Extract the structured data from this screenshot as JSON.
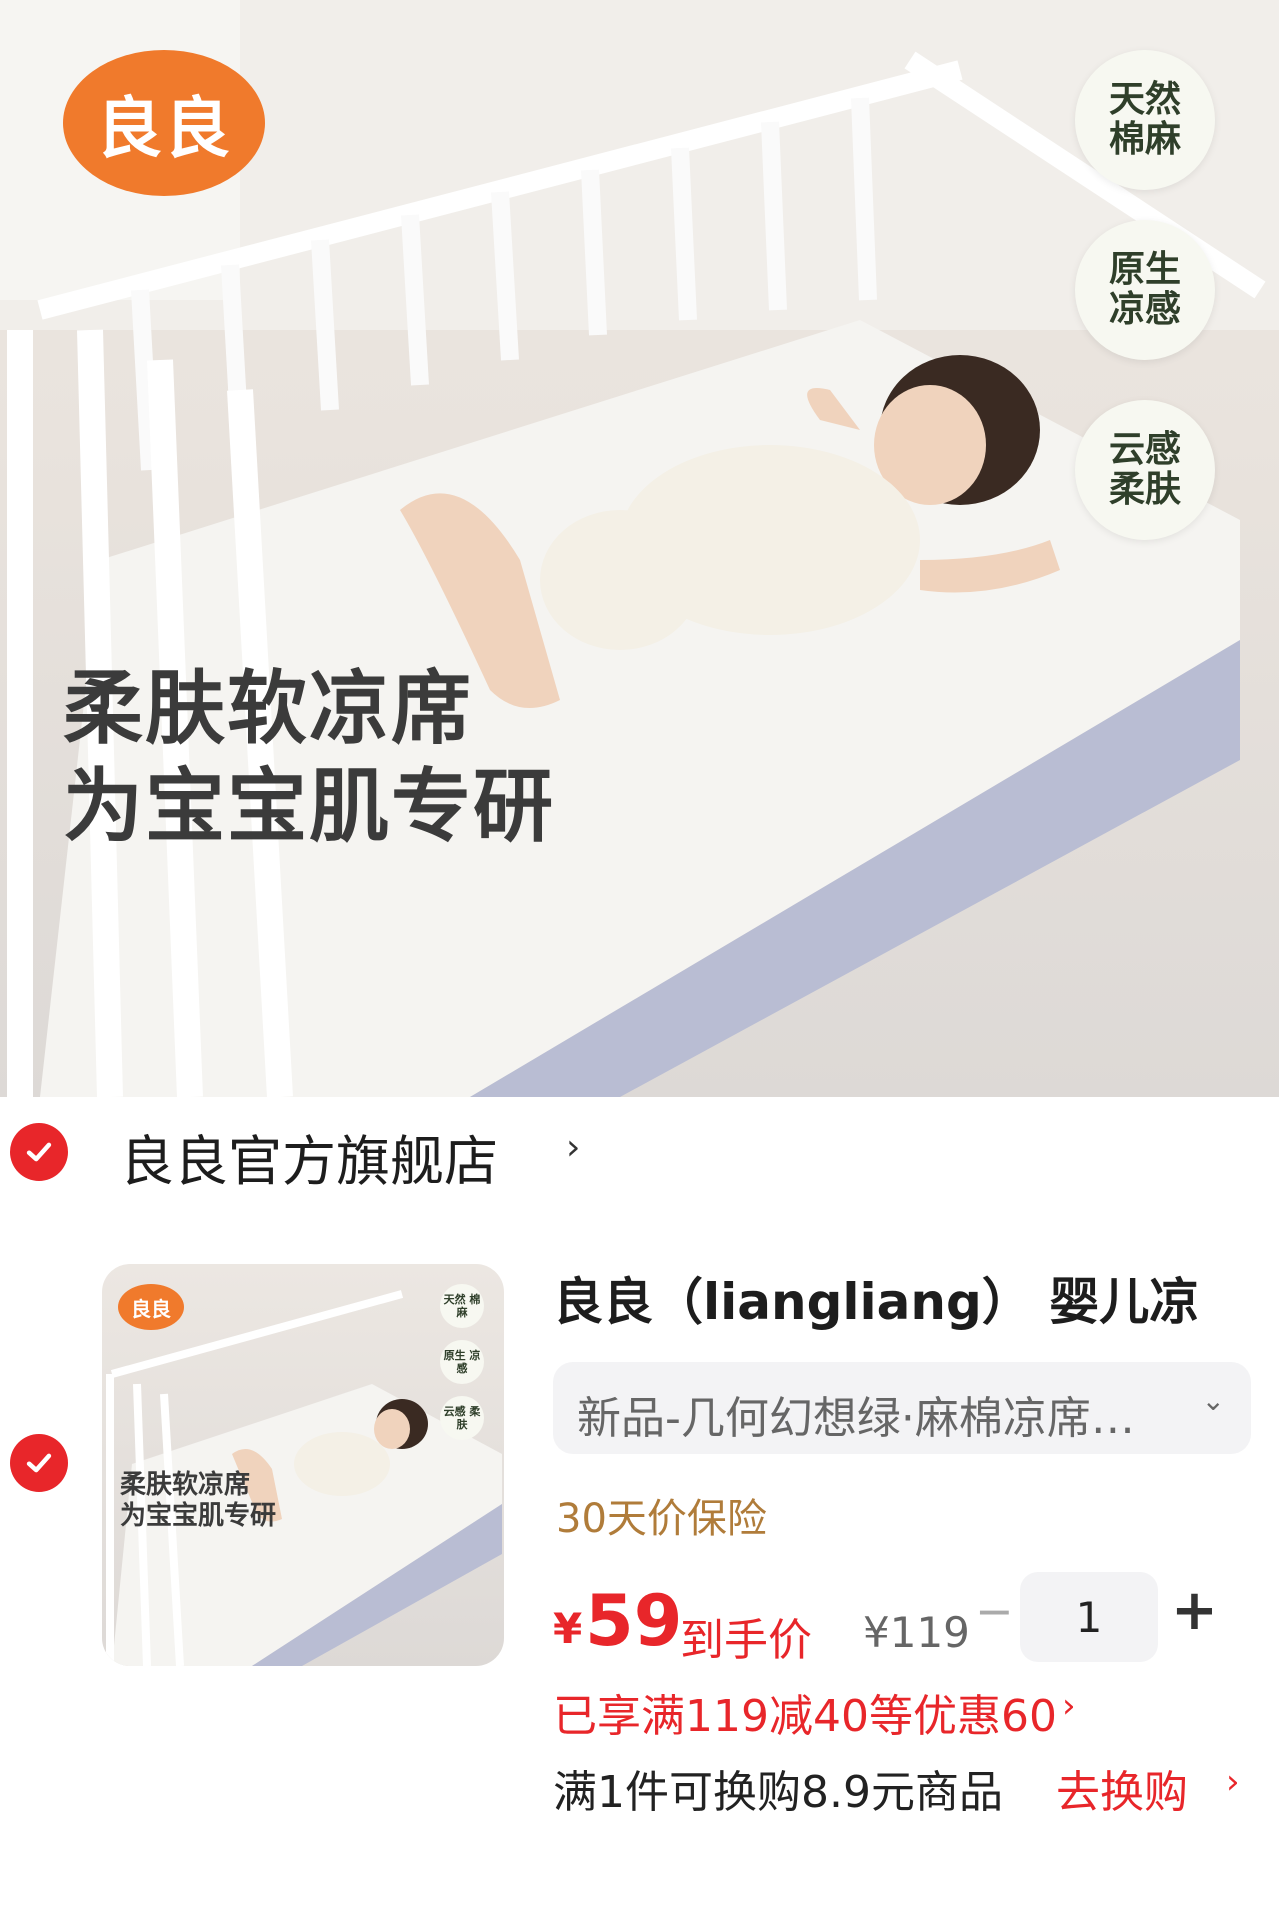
{
  "hero": {
    "brand_logo": "良良",
    "badges": [
      "天然\n棉麻",
      "原生\n凉感",
      "云感\n柔肤"
    ],
    "title_line1": "柔肤软凉席",
    "title_line2": "为宝宝肌专研"
  },
  "store": {
    "name": "良良官方旗舰店",
    "chevron": "›",
    "checkbox_checked": true
  },
  "product": {
    "checkbox_checked": true,
    "thumbnail": {
      "brand_logo": "良良",
      "badges": [
        "天然\n棉麻",
        "原生\n凉感",
        "云感\n柔肤"
      ],
      "title_line1": "柔肤软凉席",
      "title_line2": "为宝宝肌专研"
    },
    "title": "良良（liangliang） 婴儿凉",
    "variant": "新品-几何幻想绿·麻棉凉席…",
    "variant_chevron": "⌄",
    "insurance": "30天价保险",
    "price": {
      "currency": "¥",
      "amount": "59",
      "label": "到手价",
      "original": "¥119"
    },
    "quantity": {
      "minus": "−",
      "value": "1",
      "plus": "+"
    },
    "promo": "已享满119减40等优惠60",
    "promo_chevron": "›",
    "exchange_text": "满1件可换购8.9元商品",
    "exchange_button": "去换购",
    "exchange_chevron": "›"
  },
  "colors": {
    "accent_red": "#e8262a",
    "brand_orange": "#f07a2c",
    "insurance_gold": "#b07c3a"
  }
}
